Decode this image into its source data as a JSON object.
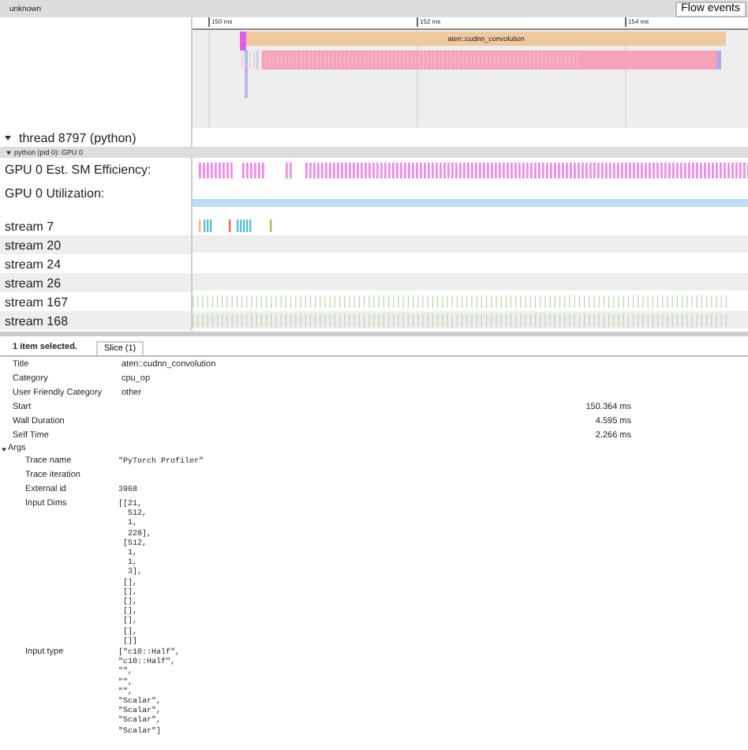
{
  "header": {
    "title": "unknown",
    "flow_button": "Flow events"
  },
  "ruler": {
    "ticks": [
      "150 ms",
      "152 ms",
      "154 ms"
    ]
  },
  "slice": {
    "label": "aten::cudnn_convolution"
  },
  "thread": {
    "label": "thread 8797 (python)",
    "expanded": true
  },
  "process": {
    "label": "python (pid 0): GPU 0",
    "expanded": true
  },
  "tracks": [
    {
      "label": "GPU 0 Est. SM Efficiency:",
      "kind": "counter"
    },
    {
      "label": "GPU 0 Utilization:",
      "kind": "utilization"
    },
    {
      "label": "stream 7",
      "kind": "sparse"
    },
    {
      "label": "stream 20",
      "kind": "empty"
    },
    {
      "label": "stream 24",
      "kind": "empty"
    },
    {
      "label": "stream 26",
      "kind": "empty"
    },
    {
      "label": "stream 167",
      "kind": "ticks"
    },
    {
      "label": "stream 168",
      "kind": "ticks"
    }
  ],
  "panel": {
    "summary": "1 item selected.",
    "tabs": [
      {
        "label": "Slice (1)",
        "selected": true
      }
    ],
    "fields": [
      {
        "label": "Title",
        "value": "aten::cudnn_convolution",
        "kind": "text"
      },
      {
        "label": "Category",
        "value": "cpu_op",
        "kind": "text"
      },
      {
        "label": "User Friendly Category",
        "value": "other",
        "kind": "text"
      },
      {
        "label": "Start",
        "value": "150.364 ms",
        "kind": "time"
      },
      {
        "label": "Wall Duration",
        "value": "4.595 ms",
        "kind": "time"
      },
      {
        "label": "Self Time",
        "value": "2.266 ms",
        "kind": "time"
      }
    ],
    "args": {
      "label": "Args",
      "expanded": true,
      "items": [
        {
          "label": "Trace name",
          "lines": [
            "\"PyTorch Profiler\""
          ]
        },
        {
          "label": "Trace iteration"
        },
        {
          "label": "External id",
          "lines": [
            "3968"
          ]
        },
        {
          "label": "Input Dims",
          "lines": [
            "[[21,",
            "  512,",
            "  1,",
            "  228],",
            " [512,",
            "  1,",
            "  1,",
            "  3],",
            " [],",
            " [],",
            " [],",
            " [],",
            " [],",
            " [],",
            " []]"
          ]
        },
        {
          "label": "Input type",
          "lines": [
            "[\"c10::Half\",",
            "\"c10::Half\",",
            "\"\",",
            "\"\",",
            "\"\",",
            "\"Scalar\",",
            "\"Scalar\",",
            "\"Scalar\",",
            "\"Scalar\"]"
          ]
        }
      ]
    }
  }
}
